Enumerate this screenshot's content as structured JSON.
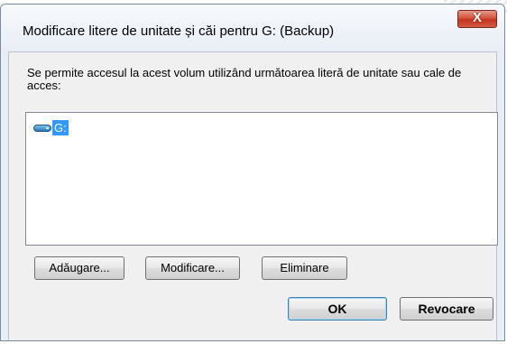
{
  "dialog": {
    "title": "Modificare litere de unitate și căi pentru G: (Backup)",
    "close_label": "X",
    "description": "Se permite accesul la acest volum utilizând următoarea literă de unitate sau cale de acces:",
    "list": {
      "items": [
        {
          "label": "G:",
          "icon": "drive-icon",
          "selected": true
        }
      ]
    },
    "buttons": {
      "add": "Adăugare...",
      "modify": "Modificare...",
      "remove": "Eliminare",
      "ok": "OK",
      "cancel": "Revocare"
    }
  },
  "colors": {
    "selection": "#3399ff",
    "close_button": "#c2341f",
    "dialog_background": "#f0f0f0"
  }
}
